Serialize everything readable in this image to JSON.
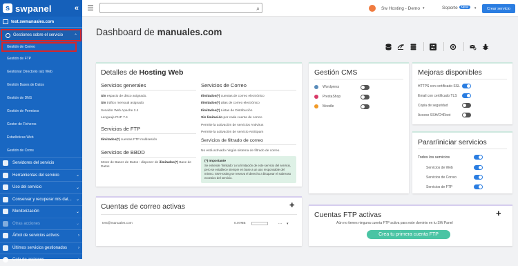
{
  "brand": {
    "logo_letter": "s",
    "name": "swpanel",
    "collapse_icon": "«",
    "accent": "#1967c2"
  },
  "sidebar": {
    "domain": "test.swmanuales.com",
    "group": {
      "label": "Gestiones sobre el servicio",
      "caret": "⌃"
    },
    "sub_items": [
      {
        "label": "Gestión de Correo"
      },
      {
        "label": "Gestión de FTP"
      },
      {
        "label": "Gestionar Directorio raíz Web"
      },
      {
        "label": "Gestión Bases de Datos"
      },
      {
        "label": "Gestión de DNS"
      },
      {
        "label": "Gestión de Permisos"
      },
      {
        "label": "Gestor de Ficheros"
      },
      {
        "label": "Estadísticas Web"
      },
      {
        "label": "Gestión de Crons"
      }
    ],
    "items": [
      {
        "label": "Servidores del servicio",
        "caret": ""
      },
      {
        "label": "Herramientas del servicio",
        "caret": "⌄"
      },
      {
        "label": "Uso del servicio",
        "caret": "⌄"
      },
      {
        "label": "Conservar y recuperar mis dat...",
        "caret": "⌄"
      },
      {
        "label": "Monitorización",
        "caret": "⌄"
      },
      {
        "label": "Otras acciones",
        "caret": "⌄"
      },
      {
        "label": "Árbol de servicios activos",
        "caret": "›"
      },
      {
        "label": "Últimos servicios gestionados",
        "caret": "›"
      },
      {
        "label": "Cola de acciones",
        "caret": "›"
      }
    ]
  },
  "topbar": {
    "search_placeholder": "",
    "search_icon": "⌕",
    "user_label": "Sw Hosting - Demo",
    "dropdown_caret": "▾",
    "support_label": "Soporte",
    "support_badge": "NEW",
    "create_button": "Crear servicio"
  },
  "main": {
    "title_prefix": "Dashboard de",
    "title_domain": "manuales.com",
    "toolbar_icons": [
      "database-icon",
      "mysql-icon",
      "database-stack-icon",
      "sliders-icon",
      "sync-icon",
      "mail-search-icon",
      "bug-icon"
    ]
  },
  "hosting": {
    "title_prefix": "Detalles de",
    "title_bold": "Hosting Web",
    "general": {
      "title": "Servicios generales",
      "lines": [
        {
          "b": "Sin",
          "t": " espacio de disco asignado."
        },
        {
          "b": "Sin",
          "t": " tráfico mensual asignado"
        },
        {
          "b": "",
          "t": "Servidor Web Apache 2.4"
        },
        {
          "b": "",
          "t": "Lenguaje PHP 7.4"
        }
      ]
    },
    "ftp": {
      "title": "Servicios de FTP",
      "lines": [
        {
          "b": "Ilimitados(*)",
          "t": " cuentas FTP multisesión"
        }
      ]
    },
    "bbdd": {
      "title": "Servicios de BBDD",
      "text_a": "Motor de Bases de Datos : disponer de ",
      "text_b": "ilimitados(*)",
      "text_c": " Base de Datos"
    },
    "mail": {
      "title": "Servicios de Correo",
      "lines": [
        {
          "b": "Ilimitados(*)",
          "t": " cuentas de correo electrónico"
        },
        {
          "b": "Ilimitados(*)",
          "t": " alias de correo electrónico"
        },
        {
          "b": "Ilimitados(*)",
          "t": " Listas de Distribución"
        },
        {
          "b": "Sin limitación",
          "t": " por cada cuenta de correo"
        },
        {
          "b": "",
          "t": "Permite la activación de servicios Antivirus"
        },
        {
          "b": "",
          "t": "Permite la activación de servicio AntiSpam"
        }
      ]
    },
    "filter": {
      "title": "Servicios de filtrado de correo",
      "line": "No está activado ningún sistema de filtrado de correo."
    },
    "note": {
      "title": "(*) Importante",
      "text": "Se entiende 'ilimitado' a no limitación de este servicio del servicio, pero se establece siempre en base a un uso responsable del mismo. SW Hosting se reserva el derecho a bloquear el sobreuso excesivo del servicio."
    }
  },
  "cms": {
    "title": "Gestión CMS",
    "items": [
      {
        "label": "Wordpress",
        "on": false,
        "color": "#5a8cba"
      },
      {
        "label": "PrestaShop",
        "on": false,
        "color": "#d83a68"
      },
      {
        "label": "Moodle",
        "on": false,
        "color": "#f19a27"
      }
    ]
  },
  "upgrades": {
    "title": "Mejoras disponibles",
    "items": [
      {
        "label": "HTTPS con certificado SSL",
        "on": true
      },
      {
        "label": "Email con certificado TLS",
        "on": true
      },
      {
        "label": "Copia de seguridad",
        "on": false
      },
      {
        "label": "Acceso SSH/CHRoot",
        "on": false
      }
    ]
  },
  "services": {
    "title": "Parar/iniciar servicios",
    "all_label": "Todos los servicios",
    "items": [
      {
        "label": "Servicios de Web",
        "on": true
      },
      {
        "label": "Servicios de Correo",
        "on": true
      },
      {
        "label": "Servicios de FTP",
        "on": true
      }
    ]
  },
  "mail_accounts": {
    "title": "Cuentas de correo activas",
    "plus": "+",
    "rows": [
      {
        "email": "test@manuales.com",
        "size": "0.07MB",
        "menu": "...",
        "caret": "▾"
      }
    ]
  },
  "ftp_accounts": {
    "title": "Cuentas FTP activas",
    "plus": "+",
    "empty_text": "Aún no tienes ninguna cuenta FTP activa para este dominio en tu SW Panel",
    "button": "Crea tu primera cuenta FTP"
  }
}
